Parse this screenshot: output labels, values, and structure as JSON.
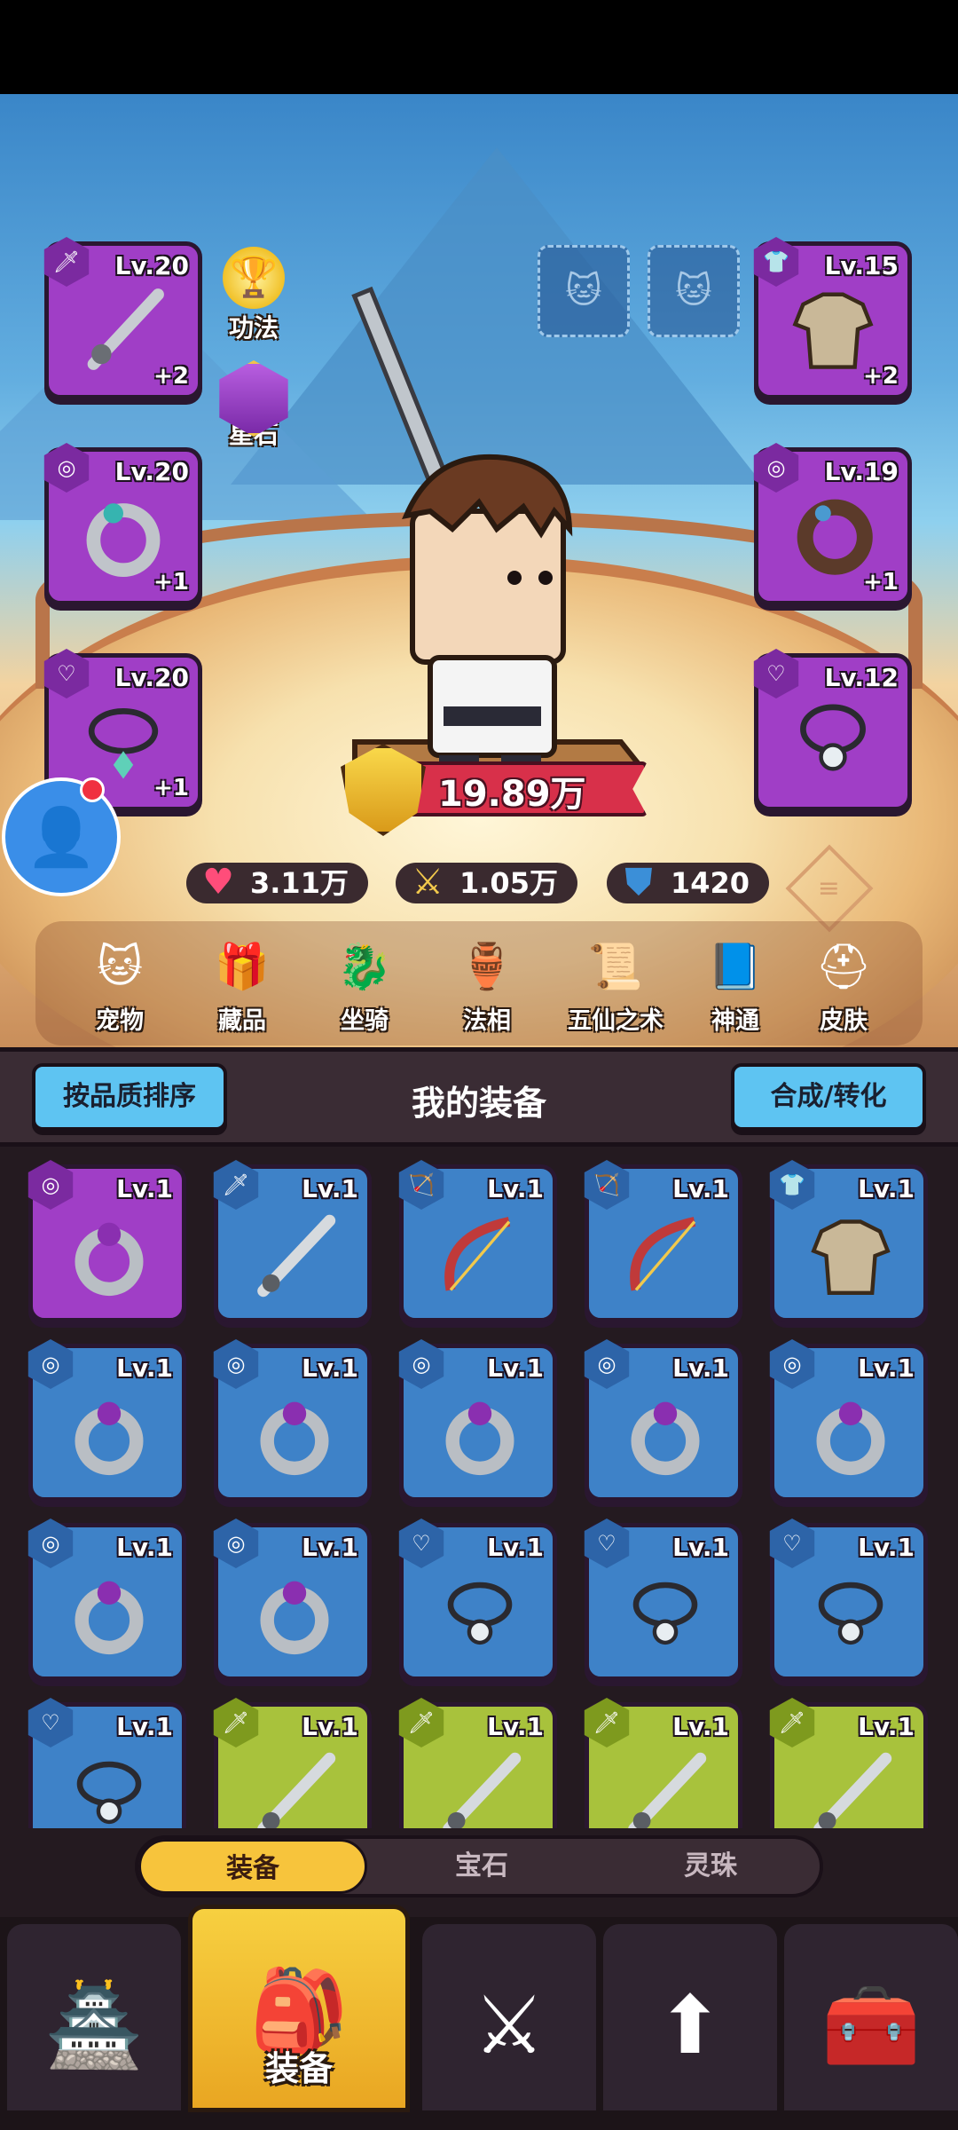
{
  "character": {
    "power": "19.89万",
    "stats": [
      {
        "icon": "heart-icon",
        "value": "3.11万",
        "color": "#ff4d7a"
      },
      {
        "icon": "sword-icon",
        "value": "1.05万",
        "color": "#f2c94c"
      },
      {
        "icon": "shield-icon",
        "value": "1420",
        "color": "#3b8fd8"
      }
    ],
    "gongfa_label": "功法",
    "xingshi_label": "星石"
  },
  "equipped": {
    "left": [
      {
        "name": "weapon",
        "level": "Lv.20",
        "plus": "+2"
      },
      {
        "name": "ring",
        "level": "Lv.20",
        "plus": "+1"
      },
      {
        "name": "necklace",
        "level": "Lv.20",
        "plus": "+1"
      }
    ],
    "right": [
      {
        "name": "armor",
        "level": "Lv.15",
        "plus": "+2"
      },
      {
        "name": "ring",
        "level": "Lv.19",
        "plus": "+1"
      },
      {
        "name": "necklace",
        "level": "Lv.12",
        "plus": ""
      }
    ]
  },
  "menu": [
    {
      "label": "宠物",
      "icon": "pet-icon"
    },
    {
      "label": "藏品",
      "icon": "chest-icon"
    },
    {
      "label": "坐骑",
      "icon": "mount-icon"
    },
    {
      "label": "法相",
      "icon": "teapot-icon"
    },
    {
      "label": "五仙之术",
      "icon": "scroll-icon"
    },
    {
      "label": "神通",
      "icon": "book-icon"
    },
    {
      "label": "皮肤",
      "icon": "helmet-icon"
    }
  ],
  "inventory": {
    "title": "我的装备",
    "sort_button": "按品质排序",
    "merge_button": "合成/转化",
    "items": [
      {
        "type": "ring",
        "color": "purple",
        "level": "Lv.1"
      },
      {
        "type": "sword",
        "color": "blue",
        "level": "Lv.1"
      },
      {
        "type": "bow",
        "color": "blue",
        "level": "Lv.1"
      },
      {
        "type": "bow",
        "color": "blue",
        "level": "Lv.1"
      },
      {
        "type": "armor",
        "color": "blue",
        "level": "Lv.1"
      },
      {
        "type": "ring",
        "color": "blue",
        "level": "Lv.1"
      },
      {
        "type": "ring",
        "color": "blue",
        "level": "Lv.1"
      },
      {
        "type": "ring",
        "color": "blue",
        "level": "Lv.1"
      },
      {
        "type": "ring",
        "color": "blue",
        "level": "Lv.1"
      },
      {
        "type": "ring",
        "color": "blue",
        "level": "Lv.1"
      },
      {
        "type": "ring",
        "color": "blue",
        "level": "Lv.1"
      },
      {
        "type": "ring",
        "color": "blue",
        "level": "Lv.1"
      },
      {
        "type": "necklace",
        "color": "blue",
        "level": "Lv.1"
      },
      {
        "type": "necklace",
        "color": "blue",
        "level": "Lv.1"
      },
      {
        "type": "necklace",
        "color": "blue",
        "level": "Lv.1"
      },
      {
        "type": "necklace",
        "color": "blue",
        "level": "Lv.1"
      },
      {
        "type": "sword",
        "color": "green",
        "level": "Lv.1"
      },
      {
        "type": "sword",
        "color": "green",
        "level": "Lv.1"
      },
      {
        "type": "sword",
        "color": "green",
        "level": "Lv.1"
      },
      {
        "type": "sword",
        "color": "green",
        "level": "Lv.1"
      }
    ]
  },
  "subtabs": [
    {
      "label": "装备",
      "active": true
    },
    {
      "label": "宝石",
      "active": false
    },
    {
      "label": "灵珠",
      "active": false
    }
  ],
  "bottom_nav": [
    {
      "icon": "shop-icon",
      "label": ""
    },
    {
      "icon": "equipment-icon",
      "label": "装备",
      "active": true
    },
    {
      "icon": "battle-icon",
      "label": ""
    },
    {
      "icon": "upgrade-icon",
      "label": ""
    },
    {
      "icon": "treasure-icon",
      "label": ""
    }
  ]
}
